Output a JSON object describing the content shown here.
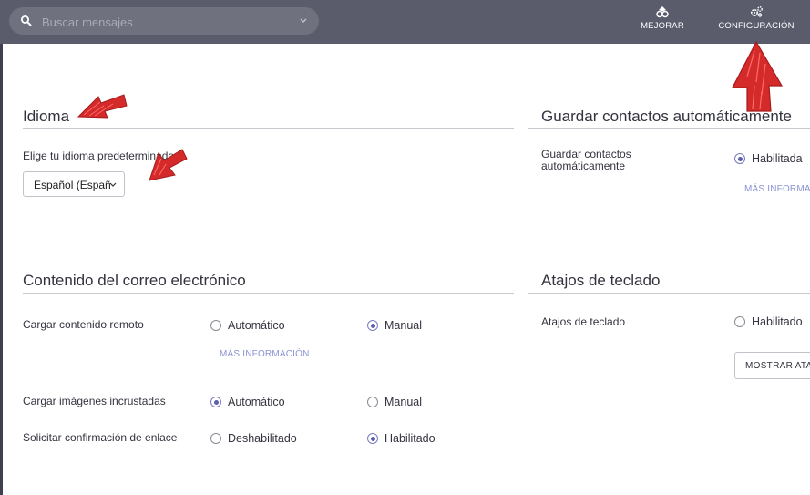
{
  "topbar": {
    "search": {
      "placeholder": "Buscar mensajes",
      "value": ""
    },
    "upgrade_label": "MEJORAR",
    "settings_label": "CONFIGURACIÓN"
  },
  "language": {
    "title": "Idioma",
    "description": "Elige tu idioma predeterminado.",
    "selected": "Español (España)"
  },
  "email_content": {
    "title": "Contenido del correo electrónico",
    "rows": [
      {
        "label": "Cargar contenido remoto",
        "options": [
          "Automático",
          "Manual"
        ],
        "selected": "Manual",
        "more_info": "MÁS INFORMACIÓN"
      },
      {
        "label": "Cargar imágenes incrustadas",
        "options": [
          "Automático",
          "Manual"
        ],
        "selected": "Automático"
      },
      {
        "label": "Solicitar confirmación de enlace",
        "options": [
          "Deshabilitado",
          "Habilitado"
        ],
        "selected": "Habilitado"
      }
    ]
  },
  "autosave_contacts": {
    "title": "Guardar contactos automáticamente",
    "label": "Guardar contactos automáticamente",
    "option": "Habilitada",
    "selected": true,
    "more_info": "MÁS INFORMACIÓN"
  },
  "shortcuts": {
    "title": "Atajos de teclado",
    "label": "Atajos de teclado",
    "option": "Habilitado",
    "selected": false,
    "button_label": "MOSTRAR ATAJOS"
  },
  "colors": {
    "topbar": "#5a5b6b",
    "accent": "#5b5fb0",
    "link": "#8b93d4",
    "annotation_arrow": "#d42a2a"
  },
  "icons": {
    "search": "search-icon",
    "upgrade": "upgrade-icon",
    "settings": "gears-icon"
  }
}
